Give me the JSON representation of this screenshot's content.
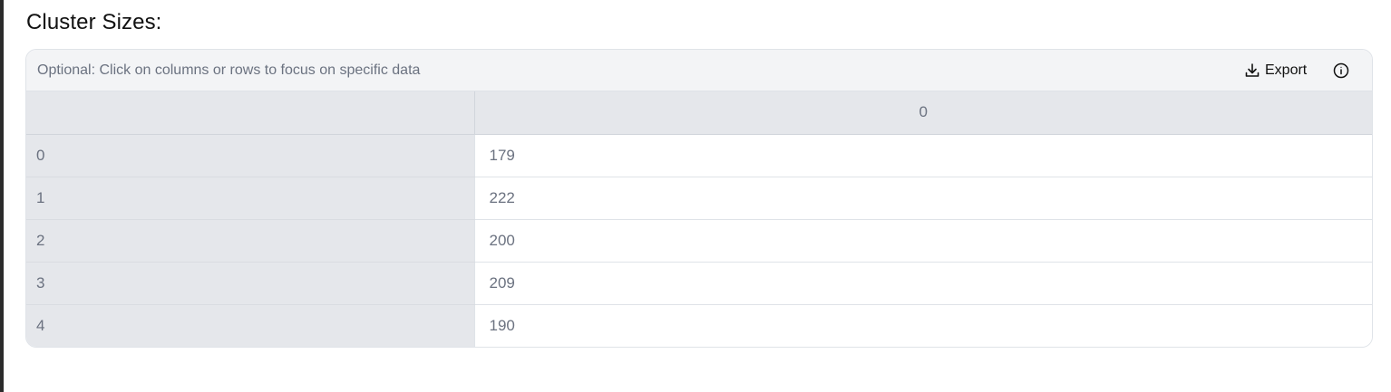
{
  "title": "Cluster Sizes:",
  "toolbar": {
    "hint": "Optional: Click on columns or rows to focus on specific data",
    "export_label": "Export",
    "export_icon": "download-icon",
    "info_icon": "info-icon"
  },
  "table": {
    "columns": [
      "",
      "0"
    ],
    "rows": [
      {
        "index": "0",
        "value": "179"
      },
      {
        "index": "1",
        "value": "222"
      },
      {
        "index": "2",
        "value": "200"
      },
      {
        "index": "3",
        "value": "209"
      },
      {
        "index": "4",
        "value": "190"
      }
    ]
  }
}
